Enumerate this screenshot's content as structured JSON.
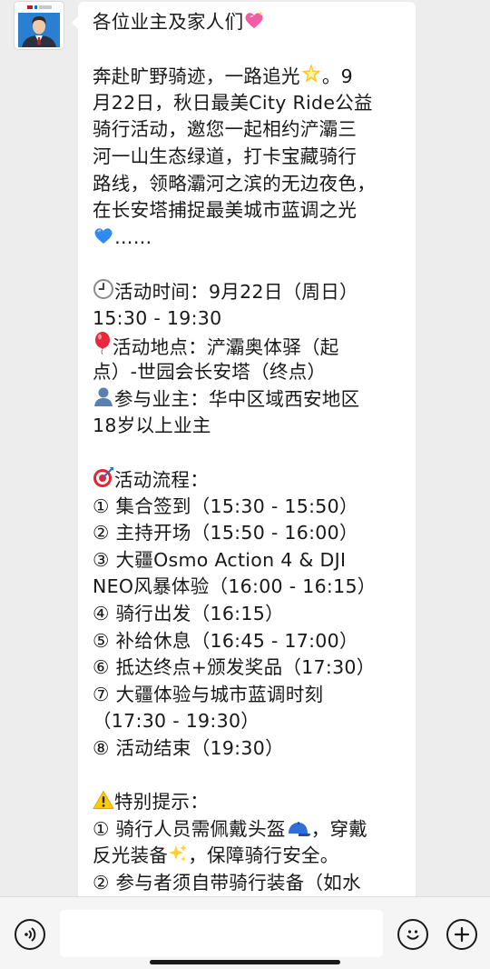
{
  "message": {
    "lines": [
      {
        "text": "各位业主及家人们",
        "emoji": "sparkling-heart"
      },
      {
        "gap": true
      },
      {
        "text": "奔赴旷野骑迹，一路追光",
        "emoji": "glowing-star",
        "after": "。9"
      },
      {
        "text": "月22日，秋日最美City Ride公益"
      },
      {
        "text": "骑行活动，邀您一起相约浐灞三"
      },
      {
        "text": "河一山生态绿道，打卡宝藏骑行"
      },
      {
        "text": "路线，领略灞河之滨的无边夜色，"
      },
      {
        "text": "在长安塔捕捉最美城市蓝调之光"
      },
      {
        "lead": "blue-heart",
        "text": "……"
      },
      {
        "gap": true
      },
      {
        "lead": "clock",
        "text": "活动时间：9月22日（周日）"
      },
      {
        "text": "15:30 - 19:30"
      },
      {
        "lead": "balloon",
        "text": "活动地点：浐灞奥体驿（起"
      },
      {
        "text": "点）-世园会长安塔（终点）"
      },
      {
        "lead": "person",
        "text": "参与业主：华中区域西安地区"
      },
      {
        "text": "18岁以上业主"
      },
      {
        "gap": true
      },
      {
        "lead": "target",
        "text": "活动流程："
      },
      {
        "text": "① 集合签到（15:30 - 15:50）"
      },
      {
        "text": "② 主持开场（15:50 - 16:00）"
      },
      {
        "text": "③ 大疆Osmo Action 4 & DJI"
      },
      {
        "text": "NEO风暴体验（16:00 - 16:15）"
      },
      {
        "text": "④ 骑行出发（16:15）"
      },
      {
        "text": "⑤ 补给休息（16:45 - 17:00）"
      },
      {
        "text": "⑥ 抵达终点+颁发奖品（17:30）"
      },
      {
        "text": "⑦ 大疆体验与城市蓝调时刻"
      },
      {
        "text": "（17:30 - 19:30）"
      },
      {
        "text": "⑧ 活动结束（19:30）"
      },
      {
        "gap": true
      },
      {
        "lead": "warning",
        "text": "特别提示："
      },
      {
        "text": "① 骑行人员需佩戴头盔",
        "emoji": "cap",
        "after": "，穿戴"
      },
      {
        "text": "反光装备",
        "emoji": "sparkles",
        "after": "，保障骑行安全。"
      },
      {
        "text": "② 参与者须自带骑行装备（如水"
      }
    ]
  },
  "inputbar": {
    "voice_icon": "voice-icon",
    "emoji_icon": "emoji-face-icon",
    "plus_icon": "plus-icon"
  },
  "colors": {
    "background": "#ededed",
    "bubble": "#ffffff",
    "text": "#191919",
    "heart_pink": "#f25ca4",
    "heart_blue": "#2f8bf0",
    "balloon_red": "#e8283c",
    "warning_yellow": "#ffcc00"
  }
}
